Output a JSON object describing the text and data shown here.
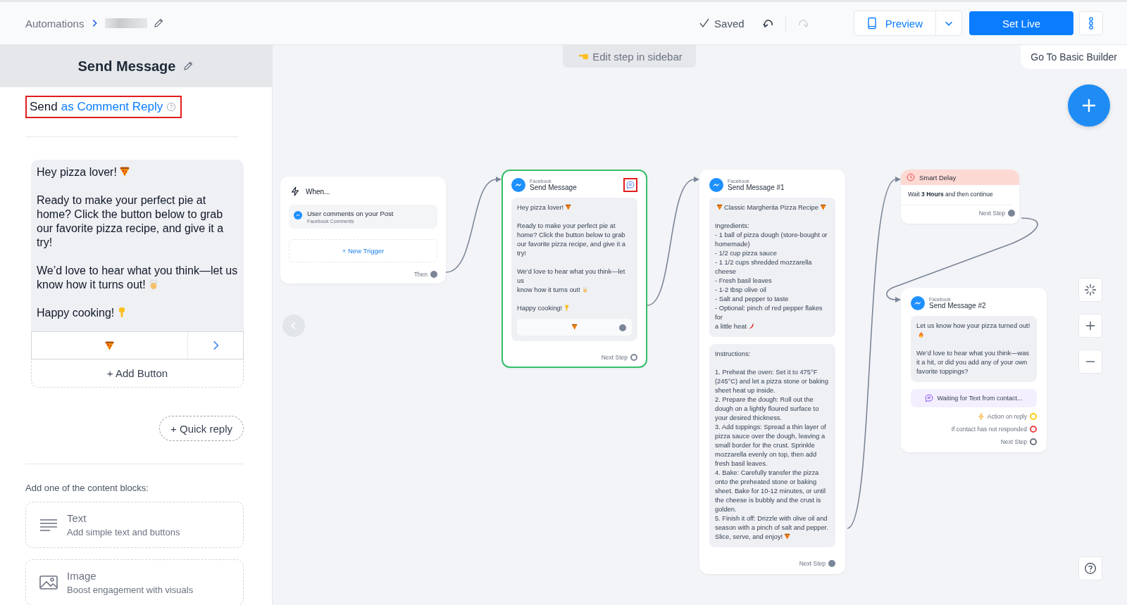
{
  "header": {
    "breadcrumb": "Automations",
    "status": "Saved",
    "undo": {
      "disabled": false
    },
    "redo": {
      "disabled": true
    },
    "preview": "Preview",
    "primary": "Set Live"
  },
  "sidebar": {
    "title": "Send Message",
    "send_mode": {
      "prefix": "Send",
      "link": "as Comment Reply",
      "highlighted": true
    },
    "message": {
      "paragraphs": [
        [
          [
            {
              "kind": "text",
              "text": "Hey pizza lover!"
            },
            {
              "kind": "pizza"
            }
          ]
        ],
        [
          [
            {
              "kind": "text",
              "text": "Ready to make your perfect pie at home? Click the button below to grab our favorite pizza recipe, and give it a try!"
            }
          ]
        ],
        [
          [
            {
              "kind": "text",
              "text": "We’d love to hear what you think—let us"
            }
          ],
          [
            {
              "kind": "text",
              "text": "know how it turns out!"
            },
            {
              "kind": "chef"
            }
          ]
        ],
        [
          [
            {
              "kind": "text",
              "text": "Happy cooking!"
            },
            {
              "kind": "point_down"
            }
          ]
        ]
      ],
      "button": {
        "kind": "pizza"
      },
      "add_button": "+ Add Button"
    },
    "quick_reply": "+ Quick reply",
    "blocks_label": "Add one of the content blocks:",
    "blocks": [
      {
        "kind": "text",
        "title": "Text",
        "subtitle": "Add simple text and buttons"
      },
      {
        "kind": "image",
        "title": "Image",
        "subtitle": "Boost engagement with visuals"
      }
    ]
  },
  "canvas": {
    "edit_hint": "Edit step in sidebar",
    "basic_builder": "Go To Basic Builder",
    "trigger": {
      "title": "When...",
      "event": "User comments on your Post",
      "source": "Facebook Comments",
      "new_trigger": "+ New Trigger",
      "port": {
        "label": "Then",
        "connected": true
      }
    },
    "messages": [
      {
        "platform": "Facebook",
        "title": "Send Message",
        "selected": true,
        "comment_icon": {
          "highlighted": true
        },
        "blocks": [
          {
            "paragraphs": [
              [
                [
                  {
                    "kind": "text",
                    "text": "Hey pizza lover!"
                  },
                  {
                    "kind": "pizza"
                  }
                ]
              ],
              [
                [
                  {
                    "kind": "text",
                    "text": "Ready to make your perfect pie at home? Click the button below to grab our favorite pizza recipe, and give it a try!"
                  }
                ]
              ],
              [
                [
                  {
                    "kind": "text",
                    "text": "We’d love to hear what you think—let us"
                  }
                ],
                [
                  {
                    "kind": "text",
                    "text": "know how it turns out!"
                  },
                  {
                    "kind": "chef"
                  }
                ]
              ],
              [
                [
                  {
                    "kind": "text",
                    "text": "Happy cooking!"
                  },
                  {
                    "kind": "point_down"
                  }
                ]
              ]
            ],
            "button": {
              "kind": "pizza",
              "connected": true
            }
          }
        ],
        "ports": [
          {
            "label": "Next Step",
            "connected": false
          }
        ]
      },
      {
        "platform": "Facebook",
        "title": "Send Message #1",
        "selected": false,
        "blocks": [
          {
            "paragraphs": [
              [
                [
                  {
                    "kind": "pizza"
                  },
                  {
                    "kind": "text",
                    "text": "Classic Margherita Pizza Recipe"
                  },
                  {
                    "kind": "pizza"
                  }
                ]
              ],
              [
                [
                  {
                    "kind": "text",
                    "text": "Ingredients:\n- 1 ball of pizza dough (store-bought or homemade)\n- 1/2 cup pizza sauce\n- 1 1/2 cups shredded mozzarella cheese\n- Fresh basil leaves\n- 1-2 tbsp olive oil\n- Salt and pepper to taste\n- Optional: pinch of red pepper flakes for"
                  }
                ],
                [
                  {
                    "kind": "text",
                    "text": "a little heat"
                  },
                  {
                    "kind": "chili"
                  }
                ]
              ]
            ]
          },
          {
            "paragraphs": [
              [
                [
                  {
                    "kind": "text",
                    "text": "Instructions:"
                  }
                ]
              ],
              [
                [
                  {
                    "kind": "text",
                    "text": "1. Preheat the oven: Set it to 475°F (245°C) and let a pizza stone or baking sheet heat up inside.\n2. Prepare the dough: Roll out the dough on a lightly floured surface to your desired thickness.\n3. Add toppings: Spread a thin layer of pizza sauce over the dough, leaving a small border for the crust. Sprinkle mozzarella evenly on top, then add fresh basil leaves.\n4. Bake: Carefully transfer the pizza onto the preheated stone or baking sheet. Bake for 10-12 minutes, or until the cheese is bubbly and the crust is golden.\n5. Finish it off: Drizzle with olive oil and season with a pinch of salt and pepper."
                  }
                ],
                [
                  {
                    "kind": "text",
                    "text": "Slice, serve, and enjoy!"
                  },
                  {
                    "kind": "pizza"
                  }
                ]
              ]
            ]
          }
        ],
        "ports": [
          {
            "label": "Next Step",
            "connected": true
          }
        ]
      },
      {
        "platform": "Facebook",
        "title": "Send Message #2",
        "selected": false,
        "blocks": [
          {
            "paragraphs": [
              [
                [
                  {
                    "kind": "text",
                    "text": "Let us know how your pizza turned out!"
                  },
                  {
                    "kind": "fire"
                  }
                ]
              ],
              [
                [
                  {
                    "kind": "text",
                    "text": "We’d love to hear what you think—was it a hit, or did you add any of your own favorite toppings?"
                  }
                ]
              ]
            ]
          }
        ],
        "waiting": "Waiting for Text from contact...",
        "ports": [
          {
            "label": "Action on reply",
            "kind": "action",
            "color": "#facc15",
            "connected": false
          },
          {
            "label": "If contact has not responded",
            "color": "#ef4444",
            "connected": false
          },
          {
            "label": "Next Step",
            "color": "#6b7280",
            "connected": false
          }
        ]
      }
    ],
    "delay": {
      "title": "Smart Delay",
      "text": "Wait **3 Hours** and then continue",
      "port": {
        "label": "Next Step",
        "connected": true
      }
    }
  }
}
